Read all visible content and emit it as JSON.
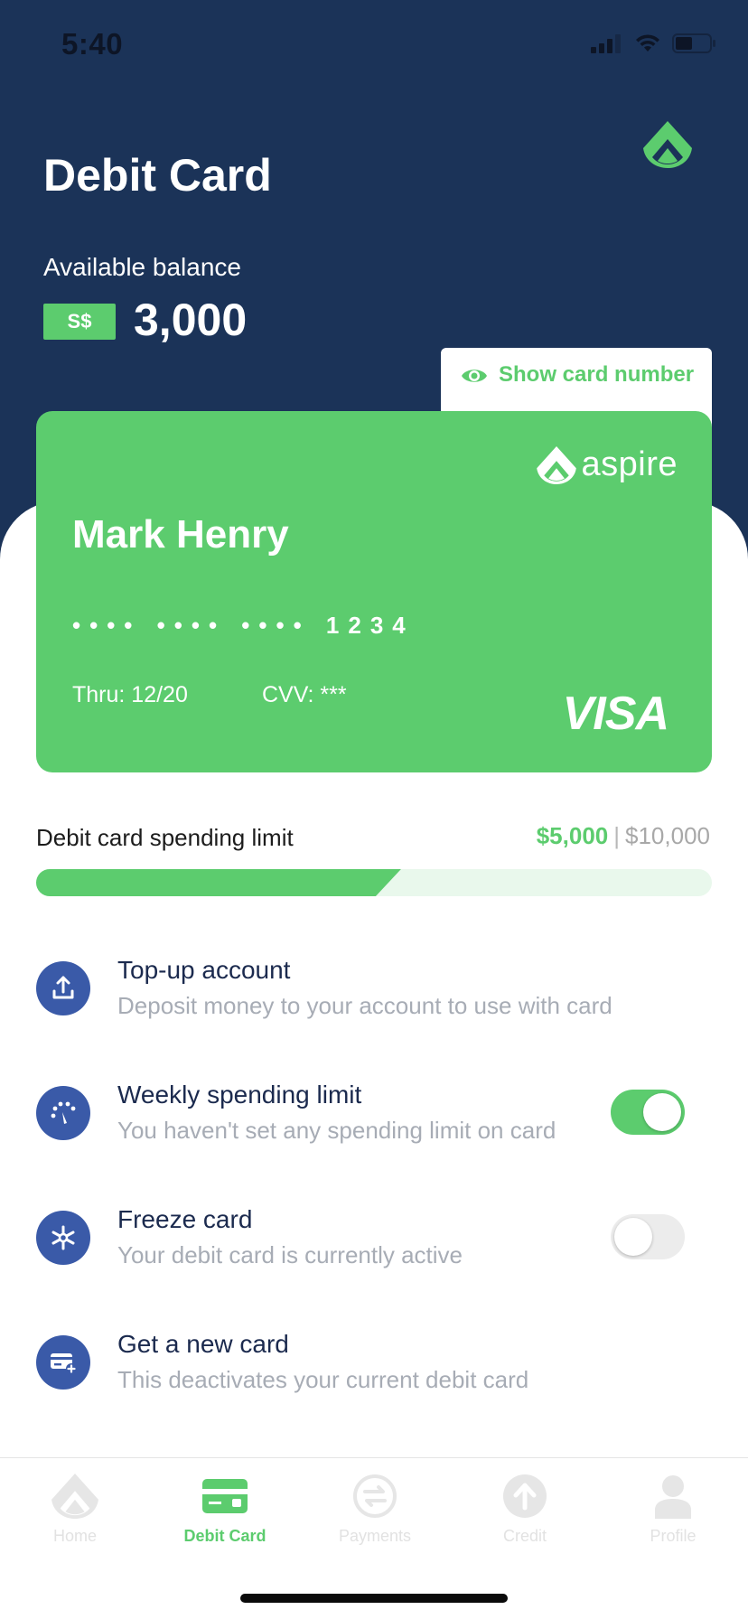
{
  "status_bar": {
    "time": "5:40"
  },
  "header": {
    "title": "Debit Card",
    "balance_label": "Available balance",
    "currency": "S$",
    "balance": "3,000",
    "show_card_number": "Show card number"
  },
  "card": {
    "brand": "aspire",
    "holder": "Mark Henry",
    "number": "•••• •••• •••• 1234",
    "expiry": "Thru: 12/20",
    "cvv": "CVV: ***",
    "network": "VISA"
  },
  "spending_limit": {
    "label": "Debit card spending limit",
    "used": "$5,000",
    "separator": "|",
    "total": "$10,000",
    "progress_fraction": 0.5
  },
  "options": [
    {
      "title": "Top-up account",
      "subtitle": "Deposit money to your account to use with card",
      "icon": "upload-icon"
    },
    {
      "title": "Weekly spending limit",
      "subtitle": "You haven't set any spending limit on card",
      "icon": "speedometer-icon",
      "toggle": true
    },
    {
      "title": "Freeze card",
      "subtitle": "Your debit card is currently active",
      "icon": "snowflake-icon",
      "toggle": false
    },
    {
      "title": "Get a new card",
      "subtitle": "This deactivates your current debit card",
      "icon": "new-card-icon"
    }
  ],
  "tabs": [
    {
      "label": "Home",
      "icon": "aspire-home-icon",
      "active": false
    },
    {
      "label": "Debit Card",
      "icon": "debit-card-icon",
      "active": true
    },
    {
      "label": "Payments",
      "icon": "payments-icon",
      "active": false
    },
    {
      "label": "Credit",
      "icon": "credit-icon",
      "active": false
    },
    {
      "label": "Profile",
      "icon": "profile-icon",
      "active": false
    }
  ],
  "colors": {
    "header_bg": "#1b3358",
    "accent_green": "#5ccc6e",
    "icon_blue": "#3a5aa8",
    "text_dark": "#1b2a4e",
    "text_muted": "#a7acb5"
  }
}
